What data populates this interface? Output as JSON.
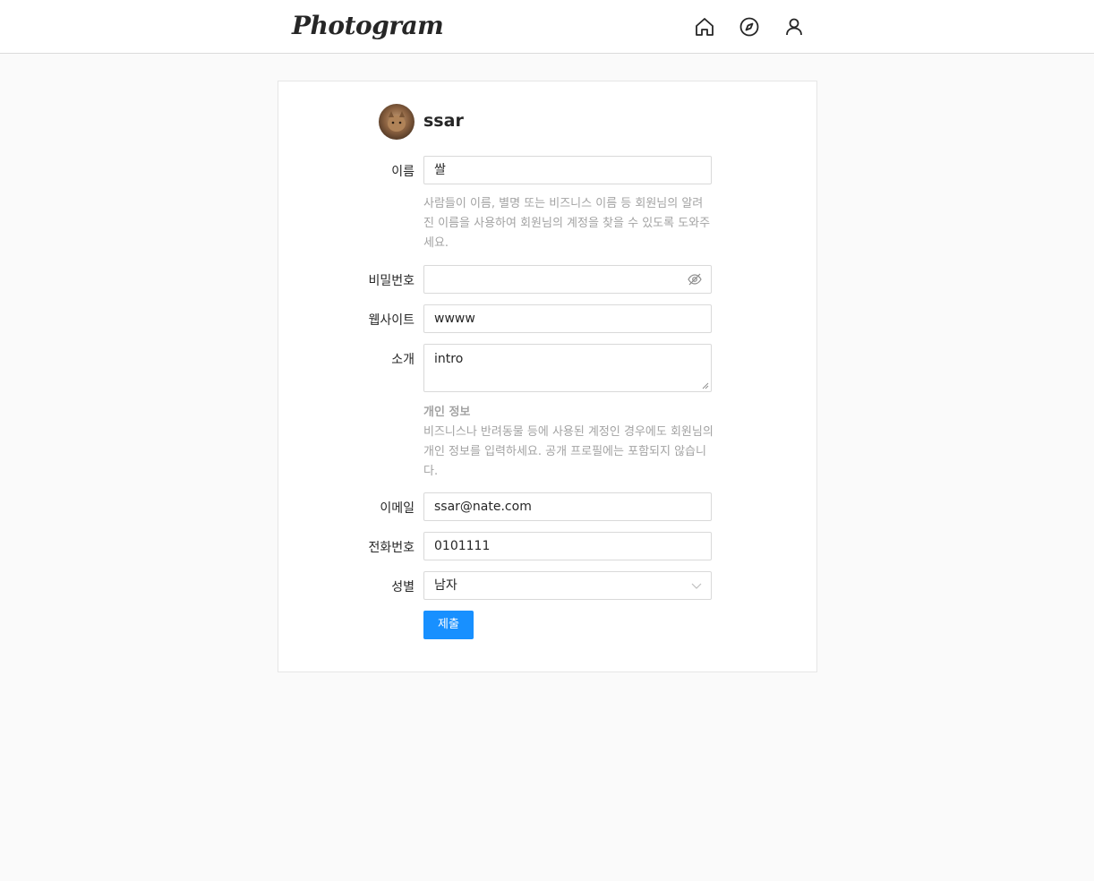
{
  "header": {
    "logo_text": "Photogram",
    "icons": [
      "home-icon",
      "explore-compass-icon",
      "profile-user-icon"
    ]
  },
  "profile": {
    "username": "ssar",
    "avatar_icon": "avatar-cat-photo"
  },
  "form": {
    "name_label": "이름",
    "name_value": "쌀",
    "name_helper": "사람들이 이름, 별명 또는 비즈니스 이름 등 회원님의 알려진 이름을 사용하여 회원님의 계정을 찾을 수 있도록 도와주세요.",
    "password_label": "비밀번호",
    "password_value": "",
    "website_label": "웹사이트",
    "website_value": "wwww",
    "bio_label": "소개",
    "bio_value": "intro",
    "private_info_title": "개인 정보",
    "private_info_helper": "비즈니스나 반려동물 등에 사용된 계정인 경우에도 회원님의 개인 정보를 입력하세요. 공개 프로필에는 포함되지 않습니다.",
    "email_label": "이메일",
    "email_value": "ssar@nate.com",
    "phone_label": "전화번호",
    "phone_value": "0101111",
    "gender_label": "성별",
    "gender_value": "남자",
    "submit_label": "제출"
  },
  "colors": {
    "accent": "#1890ff",
    "background": "#fafafa",
    "helper_text": "#a3a3a3"
  }
}
